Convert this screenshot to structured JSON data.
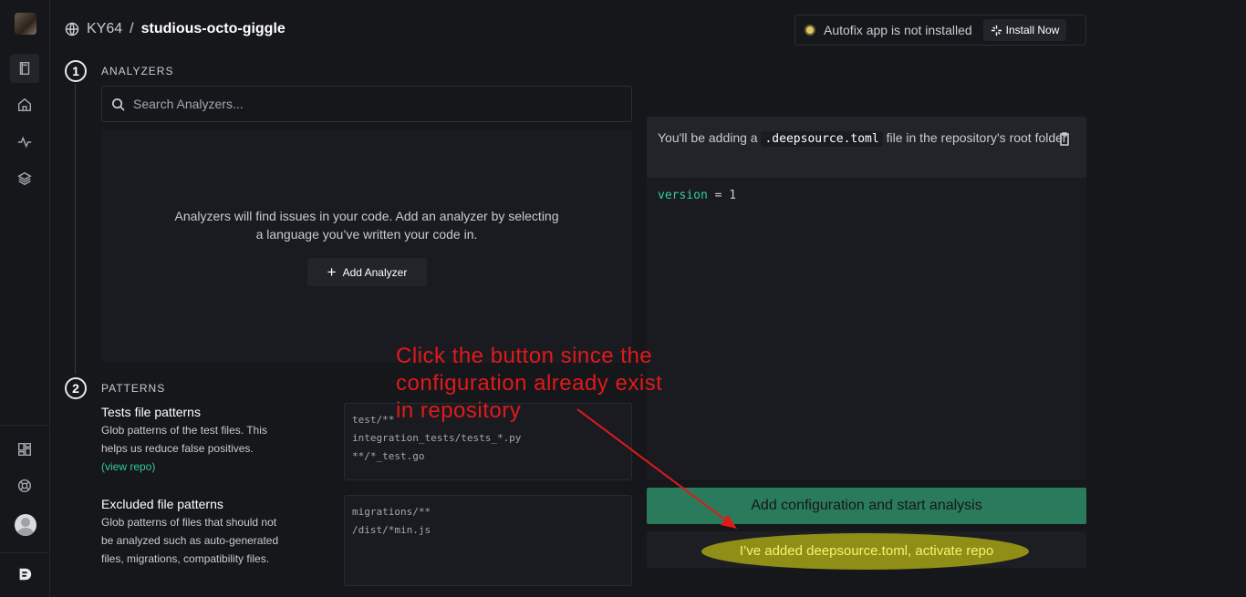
{
  "breadcrumb": {
    "owner": "KY64",
    "separator": "/",
    "repo": "studious-octo-giggle"
  },
  "autofix": {
    "status_text": "Autofix app is not installed",
    "install_label": "Install Now"
  },
  "analyzers": {
    "step_number": "1",
    "section_label": "ANALYZERS",
    "search_placeholder": "Search Analyzers...",
    "empty_text": "Analyzers will find issues in your code. Add an analyzer by selecting a language you’ve written your code in.",
    "add_button_label": "Add Analyzer"
  },
  "patterns": {
    "step_number": "2",
    "section_label": "PATTERNS",
    "test": {
      "title": "Tests file patterns",
      "description": "Glob patterns of the test files. This helps us reduce false positives.",
      "link": "(view repo)",
      "lines": [
        "test/**",
        "integration_tests/tests_*.py",
        "**/*_test.go"
      ]
    },
    "excluded": {
      "title": "Excluded file patterns",
      "description": "Glob patterns of files that should not be analyzed such as auto-generated files, migrations, compatibility files.",
      "lines": [
        "migrations/**",
        "/dist/*min.js"
      ]
    }
  },
  "config": {
    "header_prefix": "You'll be adding a",
    "filename": ".deepsource.toml",
    "header_suffix": "file in the repository's root folder.",
    "code_key": "version",
    "code_rest": " = 1"
  },
  "actions": {
    "primary_label": "Add configuration and start analysis",
    "secondary_label": "I’ve added deepsource.toml, activate repo"
  },
  "annotation": {
    "lines": [
      "Click the button since the",
      "configuration already exist",
      "in repository"
    ],
    "color": "#e01a1a"
  },
  "colors": {
    "accent": "#33cb9a",
    "primary_button": "#2a7a5c",
    "highlight": "#8f8f17"
  }
}
